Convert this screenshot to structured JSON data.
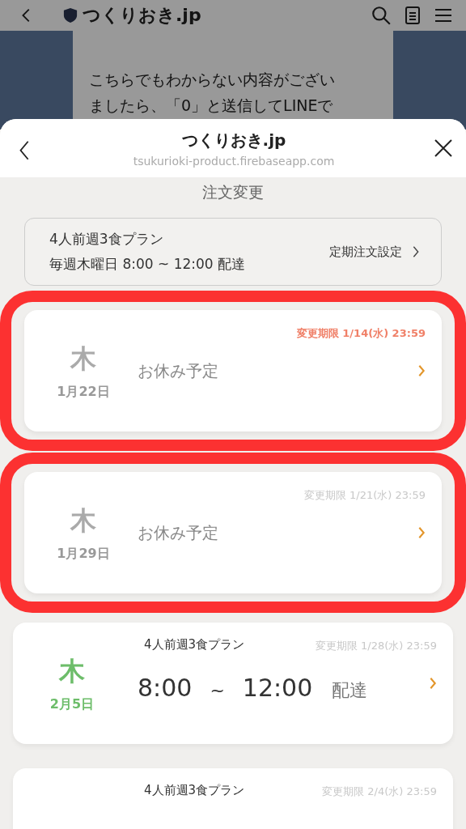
{
  "browser_bar": {
    "title": "つくりおき.jp"
  },
  "background_message": {
    "lines": [
      "こちらでもわからない内容がござい",
      "ましたら、「0」と送信してLINEで"
    ]
  },
  "sheet": {
    "title": "つくりおき.jp",
    "url": "tsukurioki-product.firebaseapp.com",
    "page_title": "注文変更"
  },
  "plan": {
    "name": "4人前週3食プラン",
    "schedule": "毎週木曜日 8:00 ~ 12:00 配達",
    "settings_link": "定期注文設定"
  },
  "orders": [
    {
      "kind": "off",
      "weekday": "木",
      "date": "1月22日",
      "deadline": "変更期限 1/14(水) 23:59",
      "urgent": true,
      "highlighted": true,
      "status": "お休み予定"
    },
    {
      "kind": "off",
      "weekday": "木",
      "date": "1月29日",
      "deadline": "変更期限 1/21(水) 23:59",
      "urgent": false,
      "highlighted": true,
      "status": "お休み予定"
    },
    {
      "kind": "delivery",
      "weekday": "木",
      "date": "2月5日",
      "deadline": "変更期限 1/28(水) 23:59",
      "urgent": false,
      "highlighted": false,
      "plan": "4人前週3食プラン",
      "time_from": "8:00",
      "separator": "~",
      "time_to": "12:00",
      "action": "配達"
    },
    {
      "kind": "delivery",
      "deadline": "変更期限 2/4(水) 23:59",
      "urgent": false,
      "highlighted": false,
      "plan": "4人前週3食プラン"
    }
  ]
}
